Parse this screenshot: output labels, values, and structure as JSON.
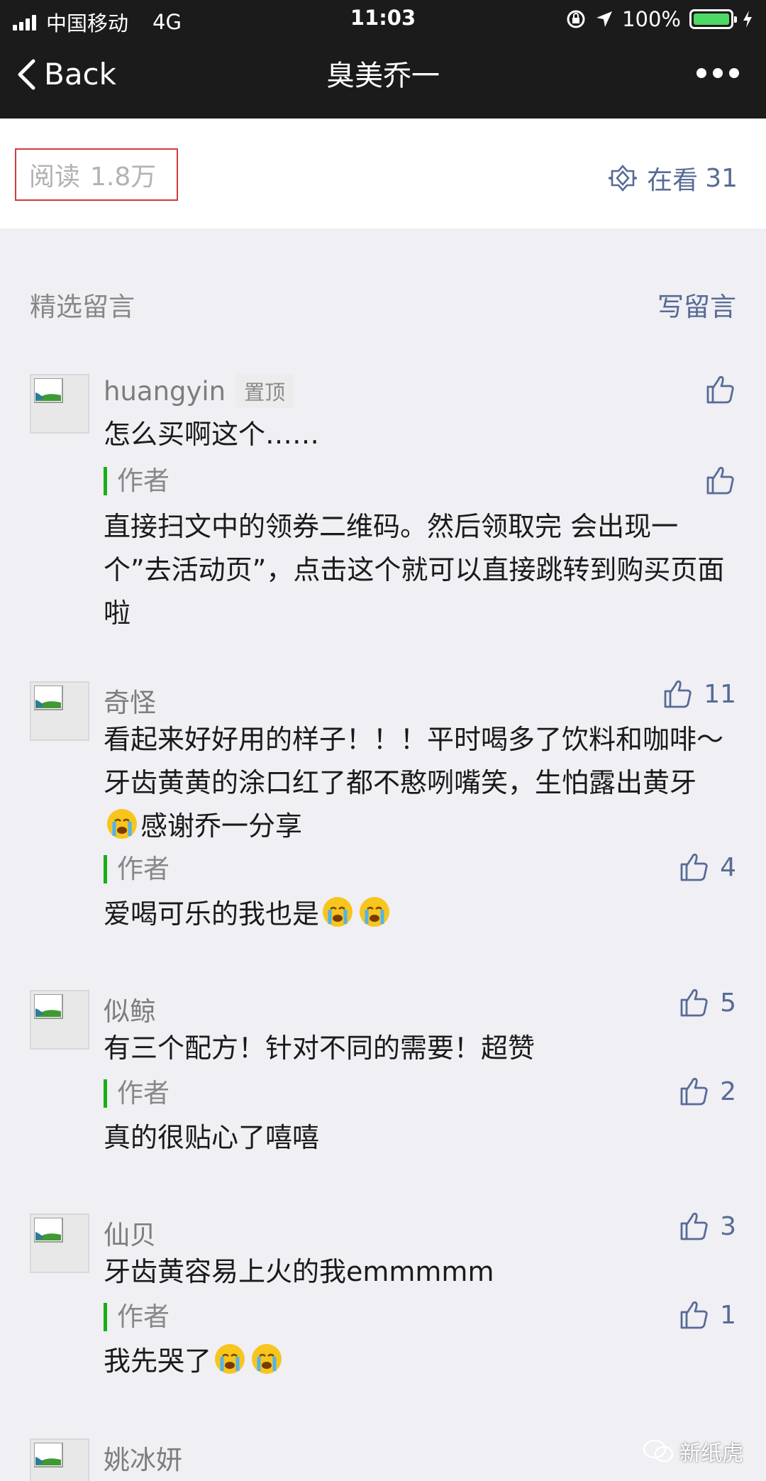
{
  "status_bar": {
    "carrier": "中国移动",
    "network": "4G",
    "time": "11:03",
    "battery": "100%"
  },
  "nav": {
    "back_label": "Back",
    "title": "臭美乔一"
  },
  "stats": {
    "read_label": "阅读",
    "read_count": "1.8万",
    "zaikan_label": "在看",
    "zaikan_count": "31"
  },
  "comments_header": {
    "featured_label": "精选留言",
    "write_label": "写留言"
  },
  "comments": [
    {
      "name": "huangyin",
      "badge": "置顶",
      "likes": "",
      "text": "怎么买啊这个……",
      "reply": {
        "label": "作者",
        "likes": "",
        "text": "直接扫文中的领券二维码。然后领取完 会出现一个”去活动页”，点击这个就可以直接跳转到购买页面啦"
      }
    },
    {
      "name": "奇怪",
      "likes": "11",
      "text_a": "看起来好好用的样子！！！平时喝多了饮料和咖啡～牙齿黄黄的涂口红了都不憨咧嘴笑，生怕露出黄牙",
      "text_b": "感谢乔一分享",
      "reply": {
        "label": "作者",
        "likes": "4",
        "text": "爱喝可乐的我也是"
      }
    },
    {
      "name": "似鲸",
      "likes": "5",
      "text": "有三个配方！针对不同的需要！超赞",
      "reply": {
        "label": "作者",
        "likes": "2",
        "text": "真的很贴心了嘻嘻"
      }
    },
    {
      "name": "仙贝",
      "likes": "3",
      "text": "牙齿黄容易上火的我emmmmm",
      "reply": {
        "label": "作者",
        "likes": "1",
        "text": "我先哭了"
      }
    },
    {
      "name": "姚冰妍",
      "likes": ""
    }
  ],
  "watermark": "新纸虎"
}
